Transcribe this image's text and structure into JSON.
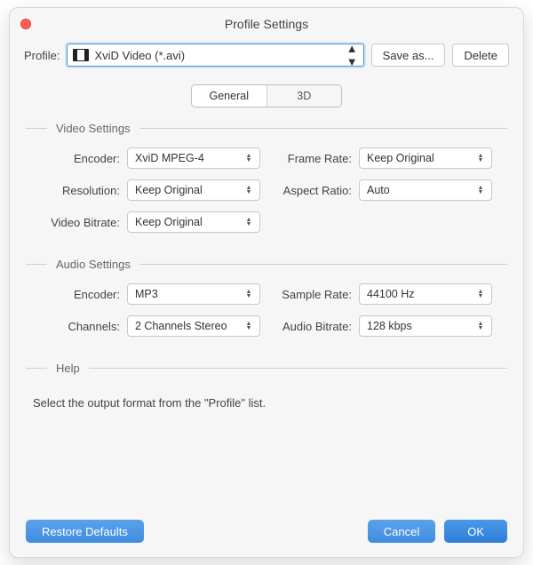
{
  "title": "Profile Settings",
  "toprow": {
    "profile_label": "Profile:",
    "profile_value": "XviD Video (*.avi)",
    "save_as": "Save as...",
    "delete": "Delete"
  },
  "tabs": {
    "general": "General",
    "three_d": "3D",
    "active": "general"
  },
  "groups": {
    "video": {
      "title": "Video Settings",
      "encoder": {
        "label": "Encoder:",
        "value": "XviD MPEG-4"
      },
      "resolution": {
        "label": "Resolution:",
        "value": "Keep Original"
      },
      "video_bitrate": {
        "label": "Video Bitrate:",
        "value": "Keep Original"
      },
      "frame_rate": {
        "label": "Frame Rate:",
        "value": "Keep Original"
      },
      "aspect_ratio": {
        "label": "Aspect Ratio:",
        "value": "Auto"
      }
    },
    "audio": {
      "title": "Audio Settings",
      "encoder": {
        "label": "Encoder:",
        "value": "MP3"
      },
      "channels": {
        "label": "Channels:",
        "value": "2 Channels Stereo"
      },
      "sample_rate": {
        "label": "Sample Rate:",
        "value": "44100 Hz"
      },
      "audio_bitrate": {
        "label": "Audio Bitrate:",
        "value": "128 kbps"
      }
    },
    "help": {
      "title": "Help",
      "text": "Select the output format from the \"Profile\" list."
    }
  },
  "footer": {
    "restore": "Restore Defaults",
    "cancel": "Cancel",
    "ok": "OK"
  }
}
